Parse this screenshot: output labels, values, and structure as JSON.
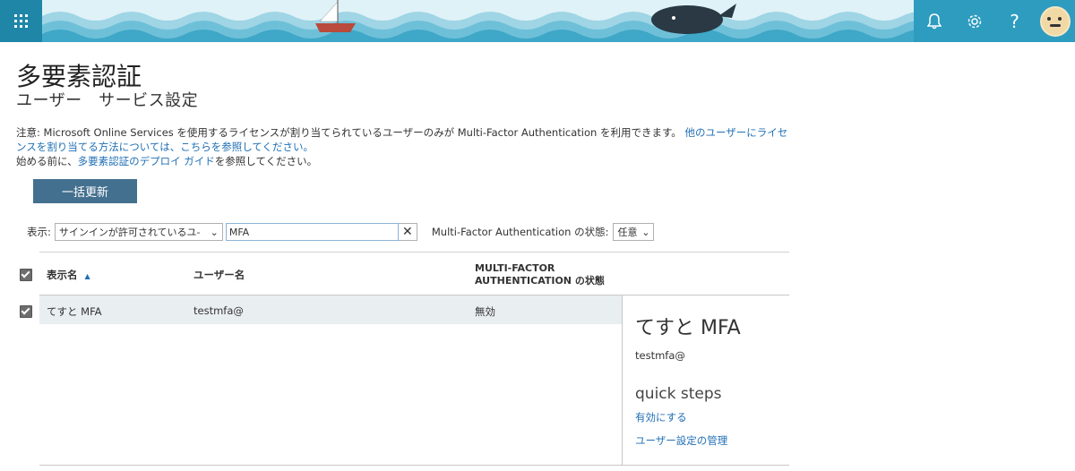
{
  "header": {
    "waffle_icon": "app-launcher-icon",
    "tools": [
      "bell-icon",
      "gear-icon",
      "help-icon",
      "avatar"
    ],
    "help_label": "?"
  },
  "page": {
    "title": "多要素認証",
    "subtitle": "ユーザー　サービス設定"
  },
  "notice": {
    "line1_prefix": "注意: Microsoft Online Services を使用するライセンスが割り当てられているユーザーのみが Multi-Factor Authentication を利用できます。",
    "line1_link": "他のユーザーにライセンスを割り当てる方法については、こちらを参照してください。",
    "line2_prefix": "始める前に、",
    "line2_link": "多要素認証のデプロイ ガイド",
    "line2_suffix": "を参照してください。"
  },
  "toolbar": {
    "bulk_update_label": "一括更新"
  },
  "filter": {
    "view_label": "表示:",
    "view_value": "サインインが許可されているユ-",
    "search_value": "MFA",
    "clear_icon": "close-icon",
    "mfa_state_label": "Multi-Factor Authentication の状態:",
    "mfa_state_value": "任意"
  },
  "table": {
    "columns": {
      "display_name": "表示名",
      "user_name": "ユーザー名",
      "mfa_line1": "MULTI-FACTOR",
      "mfa_line2": "AUTHENTICATION の状態"
    },
    "rows": [
      {
        "display_name": "てすと MFA",
        "user_name": "testmfa@",
        "mfa_state": "無効",
        "checked": true
      }
    ]
  },
  "detail": {
    "name": "てすと MFA",
    "user": "testmfa@",
    "quick_steps_title": "quick steps",
    "enable_link": "有効にする",
    "manage_link": "ユーザー設定の管理"
  },
  "colors": {
    "accent": "#1f6fb4",
    "button": "#44708f",
    "header_left": "#1f86a8",
    "header_right": "#2d9cbf",
    "row_selected": "#e9eef0"
  }
}
